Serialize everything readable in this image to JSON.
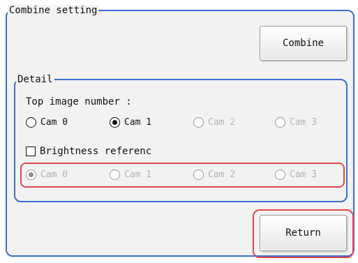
{
  "combine_setting": {
    "title": "Combine setting",
    "combine_button": "Combine"
  },
  "detail": {
    "title": "Detail",
    "top_image_label": "Top image number :",
    "top_image_options": [
      {
        "label": "Cam 0",
        "selected": false,
        "enabled": true
      },
      {
        "label": "Cam 1",
        "selected": true,
        "enabled": true
      },
      {
        "label": "Cam 2",
        "selected": false,
        "enabled": false
      },
      {
        "label": "Cam 3",
        "selected": false,
        "enabled": false
      }
    ],
    "brightness_label": "Brightness referenc",
    "brightness_checked": false,
    "brightness_options": [
      {
        "label": "Cam 0",
        "selected": true,
        "enabled": false
      },
      {
        "label": "Cam 1",
        "selected": false,
        "enabled": false
      },
      {
        "label": "Cam 2",
        "selected": false,
        "enabled": false
      },
      {
        "label": "Cam 3",
        "selected": false,
        "enabled": false
      }
    ]
  },
  "footer": {
    "return_button": "Return"
  },
  "colors": {
    "panel_border": "#3a6fd0",
    "highlight": "#e2474f",
    "disabled_text": "#b4b4b4"
  }
}
